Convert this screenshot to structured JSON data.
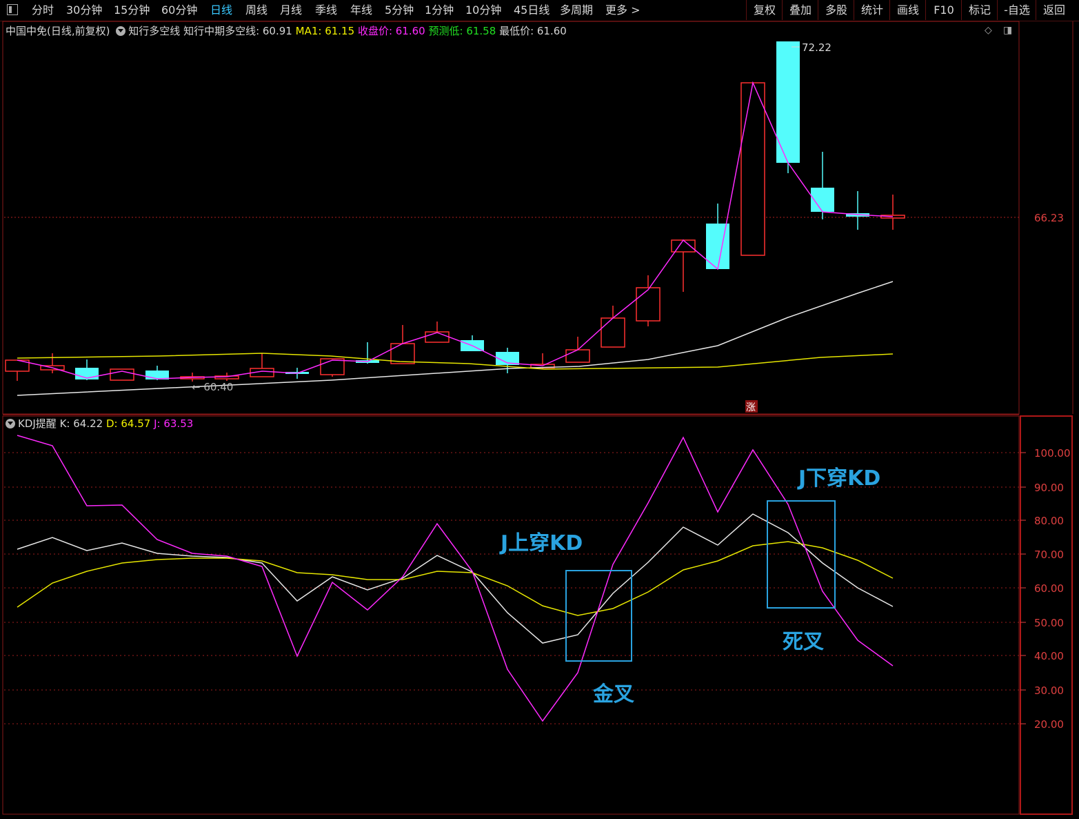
{
  "toolbar": {
    "left_items": [
      "分时",
      "30分钟",
      "15分钟",
      "60分钟",
      "日线",
      "周线",
      "月线",
      "季线",
      "年线",
      "5分钟",
      "1分钟",
      "10分钟",
      "45日线",
      "多周期",
      "更多 >"
    ],
    "active": "日线",
    "right_items": [
      "复权",
      "叠加",
      "多股",
      "统计",
      "画线",
      "F10",
      "标记",
      "-自选",
      "返回"
    ]
  },
  "main": {
    "stock": "中国中免(日线,前复权)",
    "indicator": "知行多空线",
    "line1_label": "知行中期多空线: ",
    "line1_value": "60.91",
    "ma1_label": "MA1: ",
    "ma1_value": "61.15",
    "close_label": "收盘价: ",
    "close_value": "61.60",
    "pred_label": "预测低: ",
    "pred_value": "61.58",
    "low_label": "最低价: ",
    "low_value": "61.60",
    "price_tag": "66.23",
    "high_label": "72.22",
    "low_mark": "← 60.40",
    "zhang_mark": "涨"
  },
  "kdj": {
    "title": "KDJ提醒",
    "k_label": "K: ",
    "k_value": "64.22",
    "d_label": "D: ",
    "d_value": "64.57",
    "j_label": "J: ",
    "j_value": "63.53",
    "axis_labels": [
      "100.00",
      "90.00",
      "80.00",
      "70.00",
      "60.00",
      "50.00",
      "40.00",
      "30.00",
      "20.00"
    ]
  },
  "annotations": {
    "golden_title": "J上穿KD",
    "golden_label": "金叉",
    "dead_title": "J下穿KD",
    "dead_label": "死叉"
  },
  "colors": {
    "up": "#ff3030",
    "down": "#54fcfc",
    "k": "#e8e8e8",
    "d": "#e6e600",
    "j": "#ff2aff",
    "annot": "#2aa3e0"
  }
}
